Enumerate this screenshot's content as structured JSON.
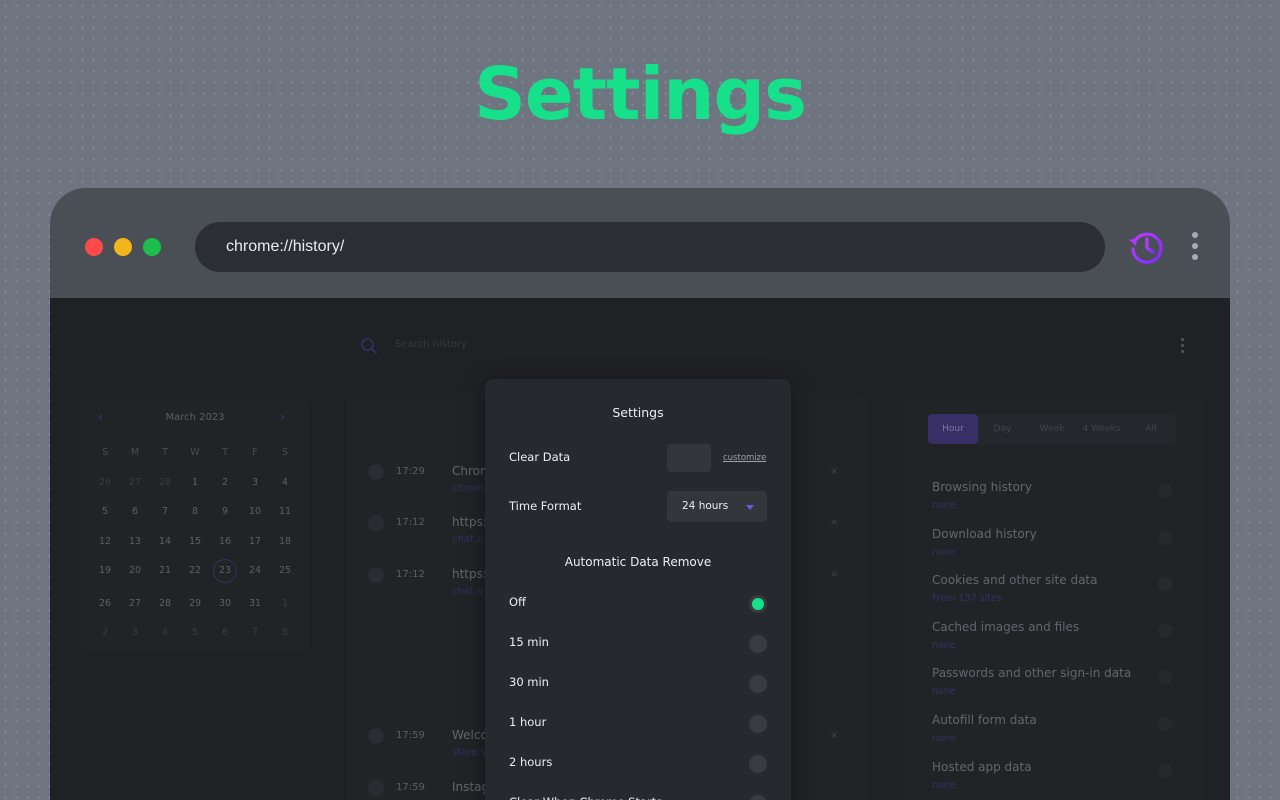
{
  "hero": {
    "title": "Settings"
  },
  "browser": {
    "url": "chrome://history/",
    "colors": {
      "accent": "#17e08a",
      "purple": "#8a2be2"
    }
  },
  "history_page": {
    "search_placeholder": "Search history",
    "calendar": {
      "month": "March 2023",
      "weekdays": [
        "S",
        "M",
        "T",
        "W",
        "T",
        "F",
        "S"
      ],
      "days": [
        [
          "26",
          "27",
          "28",
          "1",
          "2",
          "3",
          "4"
        ],
        [
          "5",
          "6",
          "7",
          "8",
          "9",
          "10",
          "11"
        ],
        [
          "12",
          "13",
          "14",
          "15",
          "16",
          "17",
          "18"
        ],
        [
          "19",
          "20",
          "21",
          "22",
          "23",
          "24",
          "25"
        ],
        [
          "26",
          "27",
          "28",
          "29",
          "30",
          "31",
          "1"
        ],
        [
          "2",
          "3",
          "4",
          "5",
          "6",
          "7",
          "8"
        ]
      ],
      "selected_day": "23"
    },
    "entries": [
      {
        "time": "17:29",
        "title": "Chrom",
        "url": "chrom"
      },
      {
        "time": "17:12",
        "title": "https:",
        "url": "chat.o"
      },
      {
        "time": "17:12",
        "title": "https:",
        "url": "chat.o"
      },
      {
        "time": "17:59",
        "title": "Welco",
        "url": "store.s"
      },
      {
        "time": "17:59",
        "title": "Instag",
        "url": ""
      }
    ],
    "ranges": [
      "Hour",
      "Day",
      "Week",
      "4 Weeks",
      "All"
    ],
    "active_range": "Hour",
    "clear_items": [
      {
        "name": "Browsing history",
        "sub": "none"
      },
      {
        "name": "Download history",
        "sub": "none"
      },
      {
        "name": "Cookies and other site data",
        "sub": "From 137 sites"
      },
      {
        "name": "Cached images and files",
        "sub": "none"
      },
      {
        "name": "Passwords and other sign-in data",
        "sub": "none"
      },
      {
        "name": "Autofill form data",
        "sub": "none"
      },
      {
        "name": "Hosted app data",
        "sub": "none"
      }
    ]
  },
  "settings_modal": {
    "title": "Settings",
    "clear_data_label": "Clear Data",
    "customize_label": "customize",
    "time_format_label": "Time Format",
    "time_format_value": "24 hours",
    "auto_remove_title": "Automatic Data Remove",
    "auto_remove_options": [
      {
        "label": "Off",
        "selected": true
      },
      {
        "label": "15 min",
        "selected": false
      },
      {
        "label": "30 min",
        "selected": false
      },
      {
        "label": "1 hour",
        "selected": false
      },
      {
        "label": "2 hours",
        "selected": false
      },
      {
        "label": "Clear When Chrome Starts",
        "selected": false
      }
    ]
  }
}
